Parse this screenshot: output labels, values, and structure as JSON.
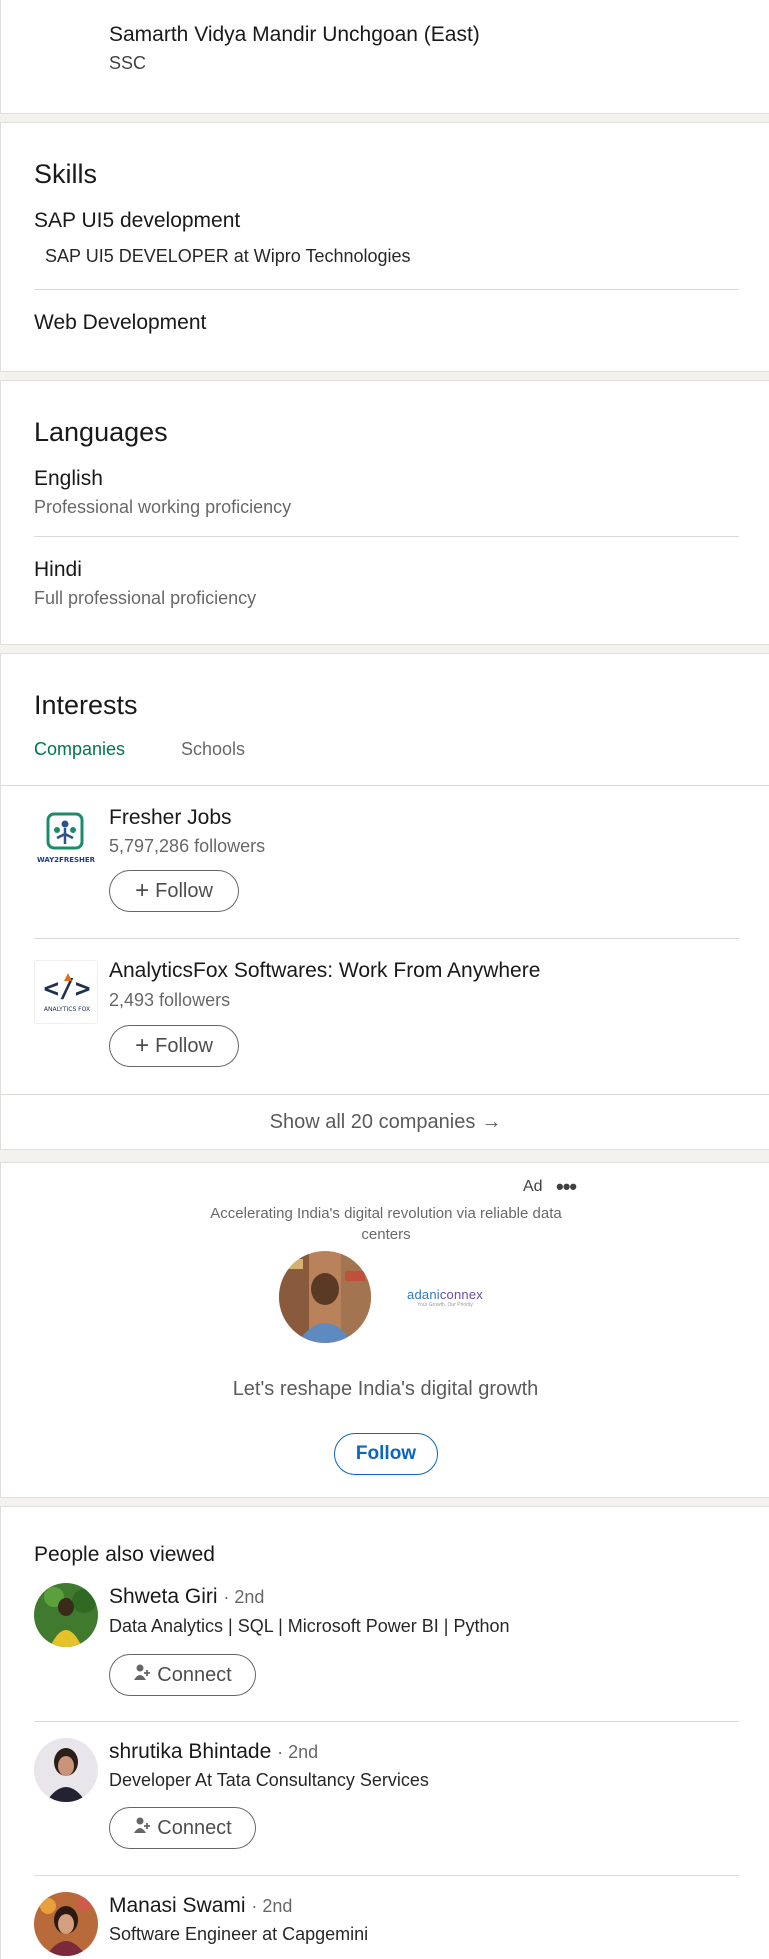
{
  "education": {
    "school": "Samarth Vidya Mandir Unchgoan (East)",
    "degree": "SSC"
  },
  "skills": {
    "title": "Skills",
    "items": [
      {
        "name": "SAP UI5 development",
        "detail": "SAP UI5 DEVELOPER at Wipro Technologies"
      },
      {
        "name": "Web Development"
      }
    ]
  },
  "languages": {
    "title": "Languages",
    "items": [
      {
        "name": "English",
        "proficiency": "Professional working proficiency"
      },
      {
        "name": "Hindi",
        "proficiency": "Full professional proficiency"
      }
    ]
  },
  "interests": {
    "title": "Interests",
    "tabs": [
      {
        "label": "Companies",
        "active": true
      },
      {
        "label": "Schools",
        "active": false
      }
    ],
    "companies": [
      {
        "name": "Fresher Jobs",
        "followers": "5,797,286 followers",
        "follow_label": "Follow",
        "logo": "wayofresher-logo",
        "logo_text": "WAY2FRESHER"
      },
      {
        "name": "AnalyticsFox Softwares: Work From Anywhere",
        "followers": "2,493 followers",
        "follow_label": "Follow",
        "logo": "analyticsfox-logo",
        "logo_text": "ANALYTICS FOX"
      }
    ],
    "show_all": "Show all 20 companies",
    "show_all_icon": "arrow-right-icon"
  },
  "ad": {
    "label": "Ad",
    "menu_icon": "more-horizontal-icon",
    "tagline": "Accelerating India's digital revolution via reliable data centers",
    "brand": {
      "name_part1": "adani",
      "name_part2": "connex",
      "tagline": "Your Growth, Our Priority"
    },
    "headline": "Let's reshape India's digital growth",
    "follow_label": "Follow",
    "accent": "#0a66c2"
  },
  "people_also_viewed": {
    "title": "People also viewed",
    "people": [
      {
        "name": "Shweta Giri",
        "degree": "· 2nd",
        "headline": "Data Analytics | SQL | Microsoft Power BI | Python",
        "action": "Connect"
      },
      {
        "name": "shrutika Bhintade",
        "degree": "· 2nd",
        "headline": "Developer At Tata Consultancy Services",
        "action": "Connect"
      },
      {
        "name": "Manasi Swami",
        "degree": "· 2nd",
        "headline": "Software Engineer at Capgemini"
      }
    ]
  },
  "colors": {
    "tab_active": "#01754f",
    "link_blue": "#0a66c2",
    "page_bg": "#f3f2ef"
  }
}
